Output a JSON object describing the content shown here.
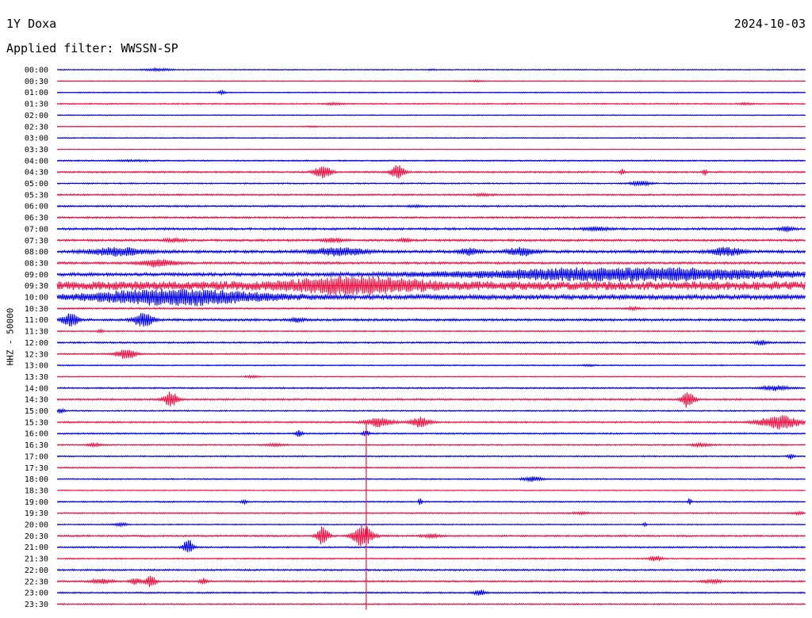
{
  "header": {
    "station": "1Y Doxa",
    "date": "2024-10-03",
    "filter": "Applied filter: WWSSN-SP"
  },
  "chart_data": {
    "type": "line",
    "title": "1Y Doxa",
    "subtitle": "Applied filter: WWSSN-SP",
    "ylabel": "HHZ - 50000",
    "xlabel": "",
    "colors": {
      "even": "#0000ee",
      "odd": "#ee1144"
    },
    "rows": [
      {
        "label": "00:00",
        "noise": 0.6,
        "events": [
          [
            13.5,
            4,
            1.5
          ],
          [
            50,
            2,
            0.5
          ]
        ]
      },
      {
        "label": "00:30",
        "noise": 0.5,
        "events": [
          [
            56,
            2,
            0.8
          ]
        ]
      },
      {
        "label": "01:00",
        "noise": 0.6,
        "events": [
          [
            22,
            1,
            2.5
          ]
        ]
      },
      {
        "label": "01:30",
        "noise": 0.8,
        "events": [
          [
            37,
            3,
            1.0
          ],
          [
            92,
            2,
            1.0
          ]
        ]
      },
      {
        "label": "02:00",
        "noise": 0.5,
        "events": []
      },
      {
        "label": "02:30",
        "noise": 0.5,
        "events": [
          [
            34,
            2,
            0.6
          ]
        ]
      },
      {
        "label": "03:00",
        "noise": 0.6,
        "events": []
      },
      {
        "label": "03:30",
        "noise": 0.4,
        "events": []
      },
      {
        "label": "04:00",
        "noise": 0.8,
        "events": [
          [
            10,
            6,
            0.8
          ]
        ]
      },
      {
        "label": "04:30",
        "noise": 1.0,
        "events": [
          [
            35.5,
            2.5,
            8
          ],
          [
            45.5,
            2,
            9
          ],
          [
            75.5,
            0.6,
            4
          ],
          [
            86.5,
            0.6,
            4
          ]
        ]
      },
      {
        "label": "05:00",
        "noise": 0.8,
        "events": [
          [
            78,
            3,
            3
          ]
        ]
      },
      {
        "label": "05:30",
        "noise": 1.0,
        "events": [
          [
            57,
            3,
            1.2
          ]
        ]
      },
      {
        "label": "06:00",
        "noise": 1.0,
        "events": [
          [
            48,
            3,
            1.0
          ]
        ]
      },
      {
        "label": "06:30",
        "noise": 1.1,
        "events": []
      },
      {
        "label": "07:00",
        "noise": 1.3,
        "events": [
          [
            72,
            4,
            2.0
          ],
          [
            97.5,
            2,
            3
          ]
        ]
      },
      {
        "label": "07:30",
        "noise": 1.3,
        "events": [
          [
            15.5,
            3,
            2
          ],
          [
            37,
            3,
            2.5
          ],
          [
            46.5,
            2,
            2
          ]
        ]
      },
      {
        "label": "08:00",
        "noise": 1.8,
        "events": [
          [
            8,
            8,
            5
          ],
          [
            37.5,
            8,
            5
          ],
          [
            55,
            3,
            4
          ],
          [
            62,
            4,
            5
          ],
          [
            89.5,
            5,
            5
          ]
        ]
      },
      {
        "label": "08:30",
        "noise": 1.4,
        "events": [
          [
            13.5,
            5,
            5
          ]
        ]
      },
      {
        "label": "09:00",
        "noise": 2.0,
        "events": [
          [
            76,
            50,
            8
          ]
        ]
      },
      {
        "label": "09:30",
        "noise": 5.5,
        "events": [
          [
            40,
            20,
            8
          ]
        ]
      },
      {
        "label": "10:00",
        "noise": 3.0,
        "events": [
          [
            16,
            26,
            9
          ]
        ]
      },
      {
        "label": "10:30",
        "noise": 1.0,
        "events": [
          [
            77,
            2,
            1.5
          ]
        ]
      },
      {
        "label": "11:00",
        "noise": 1.4,
        "events": [
          [
            1.8,
            2.5,
            8
          ],
          [
            11.5,
            3,
            9
          ],
          [
            32,
            2,
            2.5
          ]
        ]
      },
      {
        "label": "11:30",
        "noise": 0.8,
        "events": [
          [
            5.8,
            1,
            2
          ]
        ]
      },
      {
        "label": "12:00",
        "noise": 1.0,
        "events": [
          [
            94,
            2,
            3
          ]
        ]
      },
      {
        "label": "12:30",
        "noise": 0.8,
        "events": [
          [
            9.3,
            3,
            7
          ]
        ]
      },
      {
        "label": "13:00",
        "noise": 0.7,
        "events": [
          [
            71,
            2,
            1
          ]
        ]
      },
      {
        "label": "13:30",
        "noise": 0.6,
        "events": [
          [
            26,
            2,
            1.2
          ]
        ]
      },
      {
        "label": "14:00",
        "noise": 0.9,
        "events": [
          [
            96,
            4,
            3
          ]
        ]
      },
      {
        "label": "14:30",
        "noise": 1.1,
        "events": [
          [
            15.2,
            2,
            10
          ],
          [
            84.3,
            2,
            11
          ]
        ]
      },
      {
        "label": "15:00",
        "noise": 0.8,
        "events": [
          [
            0.5,
            1,
            3
          ]
        ]
      },
      {
        "label": "15:30",
        "noise": 1.0,
        "events": [
          [
            43,
            4,
            6
          ],
          [
            48.5,
            3,
            6
          ],
          [
            96.5,
            6,
            9
          ]
        ]
      },
      {
        "label": "16:00",
        "noise": 0.9,
        "events": [
          [
            32.3,
            1,
            4
          ],
          [
            41.3,
            1,
            4
          ]
        ]
      },
      {
        "label": "16:30",
        "noise": 0.8,
        "events": [
          [
            5,
            2,
            2
          ],
          [
            29,
            3,
            1.5
          ],
          [
            86,
            3,
            2
          ]
        ]
      },
      {
        "label": "17:00",
        "noise": 0.8,
        "events": [
          [
            98,
            1,
            3
          ]
        ]
      },
      {
        "label": "17:30",
        "noise": 0.8,
        "events": []
      },
      {
        "label": "18:00",
        "noise": 0.7,
        "events": [
          [
            63.5,
            3,
            3
          ]
        ]
      },
      {
        "label": "18:30",
        "noise": 0.6,
        "events": []
      },
      {
        "label": "19:00",
        "noise": 0.8,
        "events": [
          [
            25,
            1,
            2
          ],
          [
            48.5,
            0.5,
            5
          ],
          [
            84.5,
            0.5,
            5
          ]
        ]
      },
      {
        "label": "19:30",
        "noise": 0.8,
        "events": [
          [
            70,
            3,
            1.2
          ],
          [
            99,
            2,
            1.5
          ]
        ]
      },
      {
        "label": "20:00",
        "noise": 0.7,
        "events": [
          [
            8.5,
            2,
            2
          ],
          [
            78.5,
            0.6,
            2
          ]
        ]
      },
      {
        "label": "20:30",
        "noise": 1.0,
        "events": [
          [
            35.5,
            1.8,
            12
          ],
          [
            40.8,
            3,
            14
          ],
          [
            50,
            3,
            2
          ]
        ]
      },
      {
        "label": "21:00",
        "noise": 0.9,
        "events": [
          [
            17.5,
            1.5,
            10
          ]
        ]
      },
      {
        "label": "21:30",
        "noise": 0.8,
        "events": [
          [
            80,
            2,
            3
          ]
        ]
      },
      {
        "label": "22:00",
        "noise": 1.0,
        "events": []
      },
      {
        "label": "22:30",
        "noise": 1.0,
        "events": [
          [
            6,
            3,
            3
          ],
          [
            10.5,
            1.5,
            4
          ],
          [
            12.5,
            1.5,
            9
          ],
          [
            19.5,
            1,
            4
          ],
          [
            87.5,
            3,
            2
          ]
        ]
      },
      {
        "label": "23:00",
        "noise": 0.9,
        "events": [
          [
            56.5,
            2,
            3
          ]
        ]
      },
      {
        "label": "23:30",
        "noise": 0.8,
        "events": []
      }
    ],
    "spikes": [
      {
        "row": 32,
        "x": 41.3,
        "top": -1,
        "bottom": 47.5
      }
    ]
  }
}
